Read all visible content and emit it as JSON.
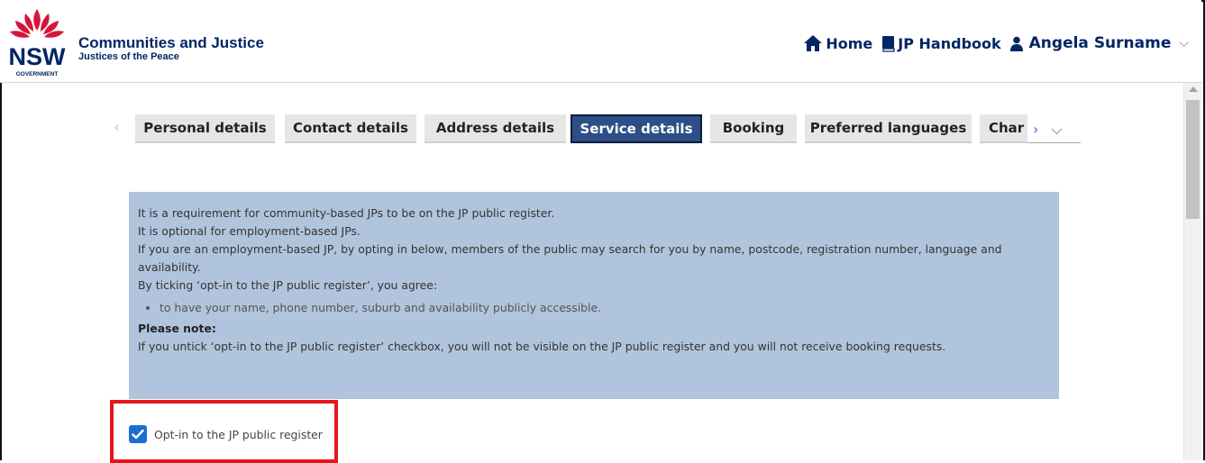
{
  "header": {
    "logo_text": "NSW",
    "logo_sub": "GOVERNMENT",
    "title": "Communities and Justice",
    "subtitle": "Justices of the Peace",
    "nav": [
      {
        "label": "Home",
        "icon": "home-icon"
      },
      {
        "label": "JP Handbook",
        "icon": "book-icon"
      }
    ],
    "user": {
      "name": "Angela Surname",
      "icon": "user-icon",
      "menu_icon": "chevron-down-icon"
    }
  },
  "tabs": [
    {
      "label": "Personal details",
      "active": false
    },
    {
      "label": "Contact details",
      "active": false
    },
    {
      "label": "Address details",
      "active": false
    },
    {
      "label": "Service details",
      "active": true
    },
    {
      "label": "Booking",
      "active": false
    },
    {
      "label": "Preferred languages",
      "active": false
    },
    {
      "label": "Char",
      "active": false
    }
  ],
  "info": {
    "lines": [
      "It is a requirement for community-based JPs to be on the JP public register.",
      "It is optional for employment-based JPs.",
      "If you are an employment-based JP, by opting in below, members of the public may search for you by name, postcode, registration number, language and availability.",
      "By ticking ‘opt-in to the JP public register’, you agree:"
    ],
    "bullet": "to have your name, phone number, suburb and availability publicly accessible.",
    "note_title": "Please note:",
    "note_text": "If you untick ‘opt-in to the JP public register’ checkbox, you will not be visible on the JP public register and you will not receive booking requests."
  },
  "optin": {
    "label": "Opt-in to the JP public register",
    "checked": true
  },
  "colors": {
    "brand_navy": "#002664",
    "nsw_red": "#d7153a",
    "active_tab": "#2b4f86",
    "info_bg": "#b1c4dd",
    "checkbox": "#1b6fd1",
    "highlight": "#e8141b"
  }
}
